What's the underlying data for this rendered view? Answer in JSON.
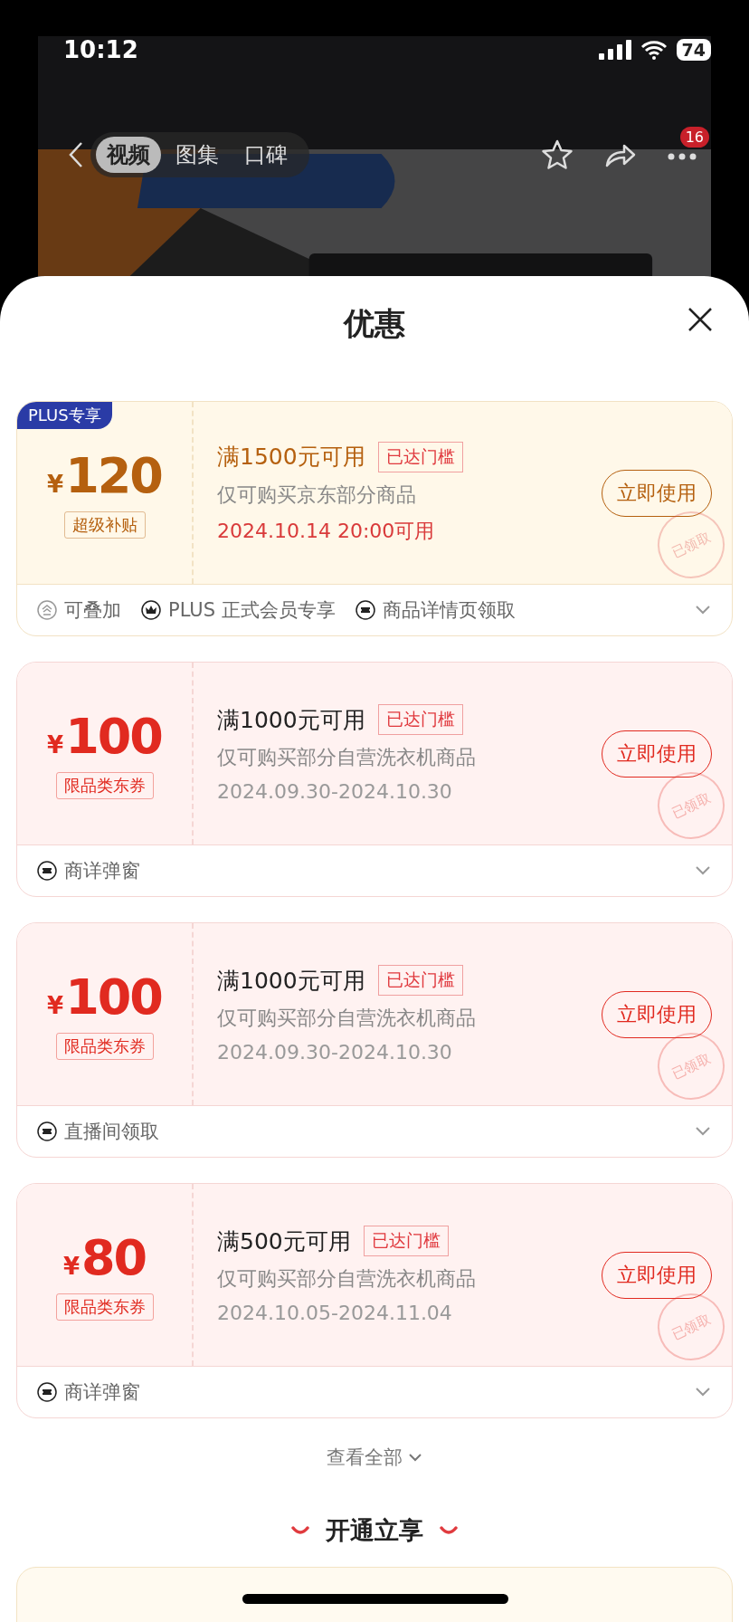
{
  "status_bar": {
    "time": "10:12",
    "battery": "74"
  },
  "nav": {
    "tabs": [
      {
        "label": "视频",
        "selected": true
      },
      {
        "label": "图集",
        "selected": false
      },
      {
        "label": "口碑",
        "selected": false
      }
    ],
    "more_badge": "16"
  },
  "sheet": {
    "title": "优惠",
    "coupons": [
      {
        "kind": "plus",
        "badge": "PLUS专享",
        "currency": "¥",
        "amount": "120",
        "tag": "超级补贴",
        "title": "满1500元可用",
        "status": "已达门槛",
        "desc": "仅可购买京东部分商品",
        "date": "2024.10.14 20:00可用",
        "button": "立即使用",
        "stamp": "已领取",
        "features": [
          {
            "kind": "stack",
            "label": "可叠加"
          },
          {
            "kind": "crown",
            "label": "PLUS 正式会员专享"
          },
          {
            "kind": "ticket",
            "label": "商品详情页领取"
          }
        ]
      },
      {
        "kind": "normal",
        "currency": "¥",
        "amount": "100",
        "tag": "限品类东券",
        "title": "满1000元可用",
        "status": "已达门槛",
        "desc": "仅可购买部分自营洗衣机商品",
        "date": "2024.09.30-2024.10.30",
        "button": "立即使用",
        "stamp": "已领取",
        "features": [
          {
            "kind": "ticket",
            "label": "商详弹窗"
          }
        ]
      },
      {
        "kind": "normal",
        "currency": "¥",
        "amount": "100",
        "tag": "限品类东券",
        "title": "满1000元可用",
        "status": "已达门槛",
        "desc": "仅可购买部分自营洗衣机商品",
        "date": "2024.09.30-2024.10.30",
        "button": "立即使用",
        "stamp": "已领取",
        "features": [
          {
            "kind": "ticket",
            "label": "直播间领取"
          }
        ]
      },
      {
        "kind": "normal",
        "currency": "¥",
        "amount": "80",
        "tag": "限品类东券",
        "title": "满500元可用",
        "status": "已达门槛",
        "desc": "仅可购买部分自营洗衣机商品",
        "date": "2024.10.05-2024.11.04",
        "button": "立即使用",
        "stamp": "已领取",
        "features": [
          {
            "kind": "ticket",
            "label": "商详弹窗"
          }
        ]
      }
    ],
    "view_all": "查看全部",
    "section_title": "开通立享"
  }
}
